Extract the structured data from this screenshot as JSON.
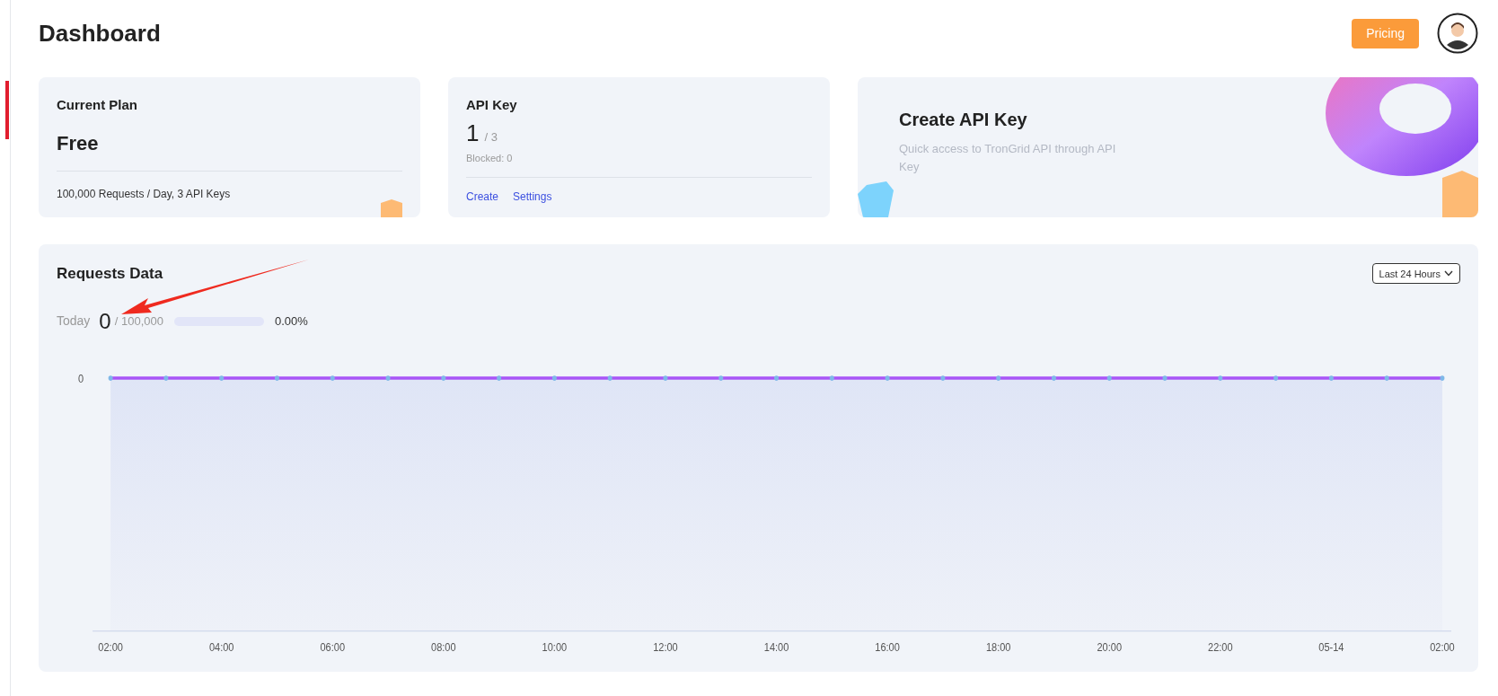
{
  "header": {
    "title": "Dashboard",
    "pricing_button": "Pricing"
  },
  "sidebar": {
    "active_marker": true
  },
  "cards": [
    {
      "kind": "plan",
      "title": "Current Plan",
      "value": "Free",
      "footer": "100,000 Requests / Day, 3 API Keys"
    },
    {
      "kind": "apikey",
      "title": "API Key",
      "value": "1",
      "total": "/ 3",
      "blocked": "Blocked: 0",
      "links": [
        "Create",
        "Settings"
      ]
    },
    {
      "kind": "promo",
      "title": "Create API Key",
      "description": "Quick access to TronGrid API through API Key"
    }
  ],
  "requests": {
    "title": "Requests Data",
    "range": "Last 24 Hours",
    "today_label": "Today",
    "today_value": "0",
    "today_limit": "/ 100,000",
    "usage": {
      "level": 0.0
    },
    "usage_text": "0.00%",
    "y_axis_tick": "0",
    "x_axis_labels": [
      "02:00",
      "04:00",
      "06:00",
      "08:00",
      "10:00",
      "12:00",
      "14:00",
      "16:00",
      "18:00",
      "20:00",
      "22:00",
      "05-14",
      "02:00"
    ]
  }
}
